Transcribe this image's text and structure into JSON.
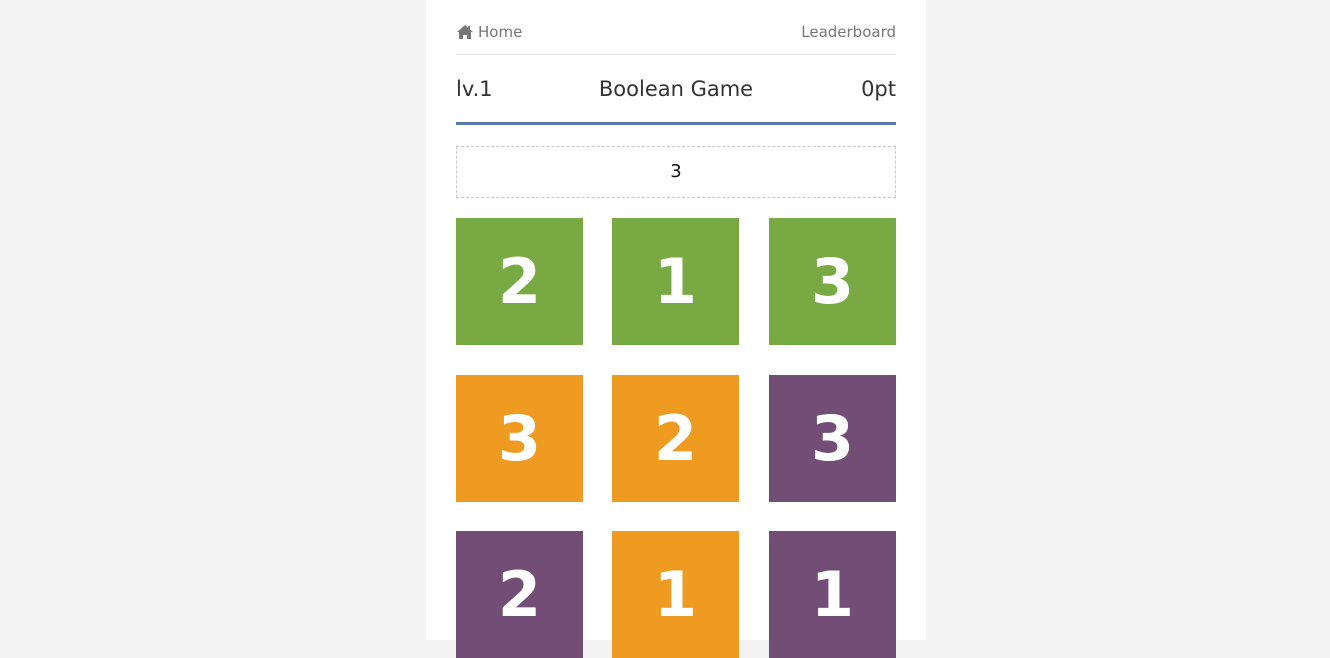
{
  "nav": {
    "home_label": "Home",
    "home_icon": "home-icon",
    "leaderboard_label": "Leaderboard"
  },
  "header": {
    "level": "lv.1",
    "title": "Boolean Game",
    "score": "0pt"
  },
  "target": {
    "value": "3"
  },
  "colors": {
    "green": "#78a943",
    "orange": "#ef9b21",
    "purple": "#724d75",
    "accent": "#5a7aae"
  },
  "tiles": [
    {
      "value": "2",
      "color": "#78a943"
    },
    {
      "value": "1",
      "color": "#78a943"
    },
    {
      "value": "3",
      "color": "#78a943"
    },
    {
      "value": "3",
      "color": "#ef9b21"
    },
    {
      "value": "2",
      "color": "#ef9b21"
    },
    {
      "value": "3",
      "color": "#724d75"
    },
    {
      "value": "2",
      "color": "#724d75"
    },
    {
      "value": "1",
      "color": "#ef9b21"
    },
    {
      "value": "1",
      "color": "#724d75"
    }
  ]
}
